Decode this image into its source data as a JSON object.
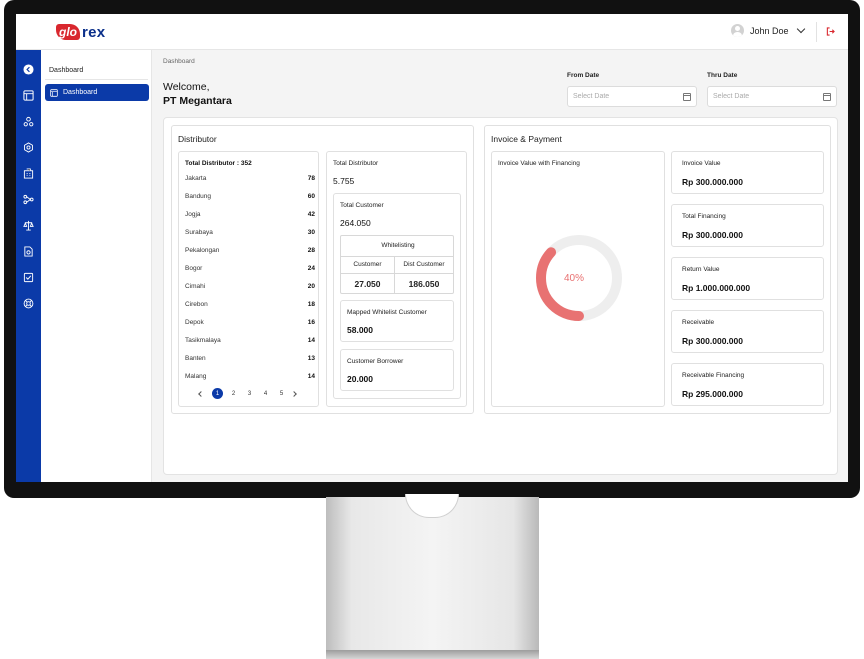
{
  "header": {
    "logo_badge": "glo",
    "logo_text": "rex",
    "user_name": "John Doe"
  },
  "submenu": {
    "title": "Dashboard",
    "active_item": "Dashboard"
  },
  "breadcrumb": "Dashboard",
  "welcome": {
    "line1": "Welcome,",
    "line2": "PT Megantara"
  },
  "filters": {
    "from_label": "From Date",
    "from_placeholder": "Select Date",
    "thru_label": "Thru Date",
    "thru_placeholder": "Select Date"
  },
  "distributor": {
    "title": "Distributor",
    "list_title": "Total Distributor : 352",
    "cities": [
      {
        "name": "Jakarta",
        "count": "78"
      },
      {
        "name": "Bandung",
        "count": "60"
      },
      {
        "name": "Jogja",
        "count": "42"
      },
      {
        "name": "Surabaya",
        "count": "30"
      },
      {
        "name": "Pekalongan",
        "count": "28"
      },
      {
        "name": "Bogor",
        "count": "24"
      },
      {
        "name": "Cimahi",
        "count": "20"
      },
      {
        "name": "Cirebon",
        "count": "18"
      },
      {
        "name": "Depok",
        "count": "16"
      },
      {
        "name": "Tasikmalaya",
        "count": "14"
      },
      {
        "name": "Banten",
        "count": "13"
      },
      {
        "name": "Malang",
        "count": "14"
      }
    ],
    "pages": [
      "1",
      "2",
      "3",
      "4",
      "5"
    ],
    "total_distributor_label": "Total Distributor",
    "total_distributor_value": "5.755",
    "total_customer_label": "Total Customer",
    "total_customer_value": "264.050",
    "whitelisting": {
      "title": "Whitelisting",
      "col1": "Customer",
      "col2": "Dist Customer",
      "val1": "27.050",
      "val2": "186.050"
    },
    "mapped_label": "Mapped Whitelist Customer",
    "mapped_value": "58.000",
    "borrower_label": "Customer Borrower",
    "borrower_value": "20.000"
  },
  "invoice": {
    "title": "Invoice & Payment",
    "chart_title": "Invoice Value with Financing",
    "donut_percent": 40,
    "donut_label": "40%",
    "colors": {
      "fill": "#e87272",
      "track": "#eeeeee"
    },
    "stats": [
      {
        "label": "Invoice Value",
        "value": "Rp 300.000.000"
      },
      {
        "label": "Total Financing",
        "value": "Rp 300.000.000"
      },
      {
        "label": "Return Value",
        "value": "Rp 1.000.000.000"
      },
      {
        "label": "Receivable",
        "value": "Rp 300.000.000"
      },
      {
        "label": "Receivable Financing",
        "value": "Rp 295.000.000"
      }
    ]
  },
  "icons": {
    "rail": [
      "back-icon",
      "dashboard-icon",
      "users-icon",
      "settings-icon",
      "building-icon",
      "flow-icon",
      "scale-icon",
      "document-icon",
      "checklist-icon",
      "support-icon"
    ]
  },
  "theme": {
    "primary": "#0b3aa8",
    "accent_red": "#d9272e"
  }
}
